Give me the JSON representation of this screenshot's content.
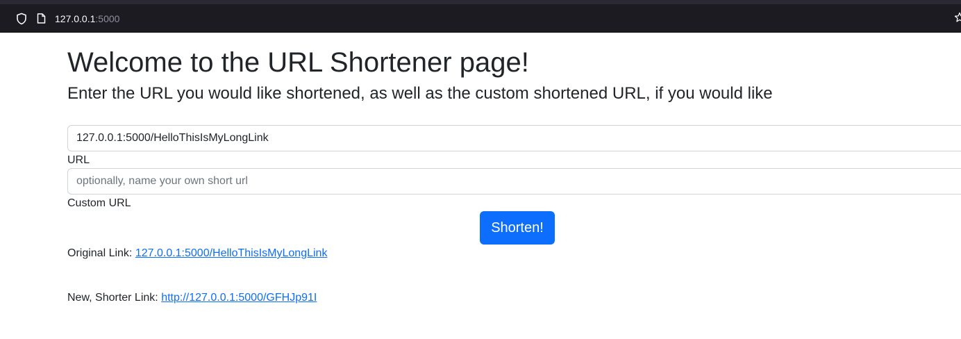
{
  "browser": {
    "address_host": "127.0.0.1",
    "address_port": ":5000",
    "icons": [
      "shield-icon",
      "page-icon",
      "star-icon"
    ]
  },
  "page": {
    "title": "Welcome to the URL Shortener page!",
    "subtitle": "Enter the URL you would like shortened, as well as the custom shortened URL, if you would like"
  },
  "form": {
    "url_value": "127.0.0.1:5000/HelloThisIsMyLongLink",
    "url_label": "URL",
    "custom_placeholder": "optionally, name your own short url",
    "custom_label": "Custom URL",
    "submit_label": "Shorten!"
  },
  "results": {
    "original_label": "Original Link:",
    "original_link": "127.0.0.1:5000/HelloThisIsMyLongLink",
    "new_label": "New, Shorter Link:",
    "new_link": "http://127.0.0.1:5000/GFHJp91I"
  },
  "colors": {
    "accent": "#0d6efd",
    "browser_chrome": "#1c1b22",
    "text": "#212529"
  }
}
